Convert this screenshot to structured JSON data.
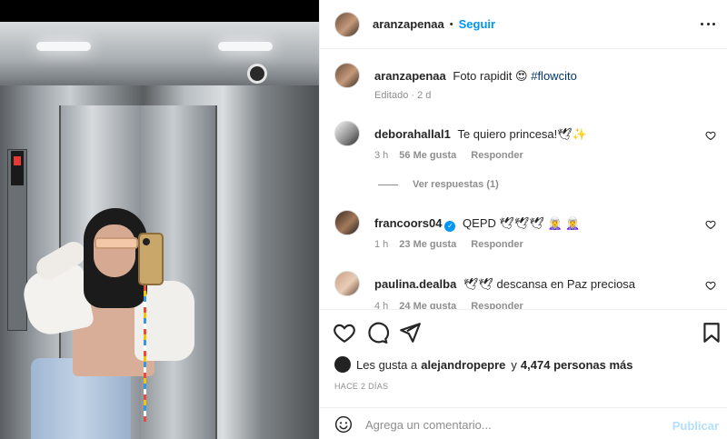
{
  "post": {
    "username": "aranzapenaa",
    "separator": "•",
    "follow_label": "Seguir",
    "caption": "Foto rapidit 😍",
    "hashtag": "#flowcito",
    "edited": "Editado · 2 d"
  },
  "comments": [
    {
      "username": "deborahallal1",
      "text": "Te quiero princesa!🕊✨",
      "age": "3 h",
      "likes": "56 Me gusta",
      "reply": "Responder",
      "verified": false
    },
    {
      "username": "francoors04",
      "text": "QEPD 🕊🕊🕊 🧝‍♀️ 🧝‍♀️",
      "age": "1 h",
      "likes": "23 Me gusta",
      "reply": "Responder",
      "verified": true
    },
    {
      "username": "paulina.dealba",
      "text": "🕊🕊 descansa en Paz preciosa",
      "age": "4 h",
      "likes": "24 Me gusta",
      "reply": "Responder",
      "verified": false
    }
  ],
  "view_replies": "Ver respuestas (1)",
  "likes": {
    "prefix": "Les gusta a",
    "user": "alejandropepre",
    "joiner": "y",
    "others": "4,474 personas más"
  },
  "timestamp": "HACE 2 DÍAS",
  "composer": {
    "placeholder": "Agrega un comentario...",
    "post_label": "Publicar"
  },
  "icons": {
    "more": "more-options-icon",
    "like": "heart-icon",
    "comment": "comment-icon",
    "share": "share-icon",
    "save": "bookmark-icon",
    "emoji": "emoji-icon",
    "verified": "verified-badge-icon"
  },
  "colors": {
    "link": "#0095f6",
    "hashtag": "#00376b",
    "muted": "#8e8e8e",
    "post_disabled": "#b2dffc"
  }
}
